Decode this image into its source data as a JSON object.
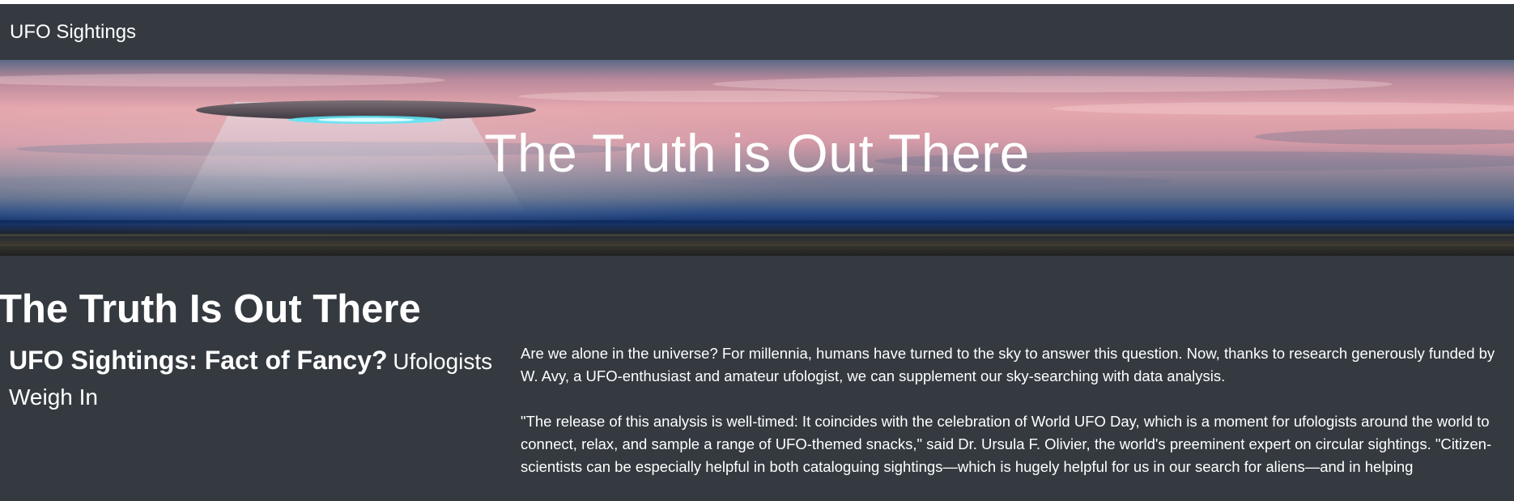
{
  "navbar": {
    "brand": "UFO Sightings"
  },
  "hero": {
    "title": "The Truth is Out There"
  },
  "page": {
    "heading": "The Truth Is Out There"
  },
  "article": {
    "title_main": "UFO Sightings: Fact of Fancy?",
    "title_sub": "Ufologists Weigh In",
    "paragraphs": [
      "Are we alone in the universe? For millennia, humans have turned to the sky to answer this question. Now, thanks to research generously funded by W. Avy, a UFO-enthusiast and amateur ufologist, we can supplement our sky-searching with data analysis.",
      "\"The release of this analysis is well-timed: It coincides with the celebration of World UFO Day, which is a moment for ufologists around the world to connect, relax, and sample a range of UFO-themed snacks,\" said Dr. Ursula F. Olivier, the world's preeminent expert on circular sightings. \"Citizen-scientists can be especially helpful in both cataloguing sightings—which is hugely helpful for us in our search for aliens—and in helping"
    ]
  },
  "colors": {
    "background": "#343a40",
    "text": "#ffffff",
    "ufo_glow": "#5fe6f5"
  }
}
